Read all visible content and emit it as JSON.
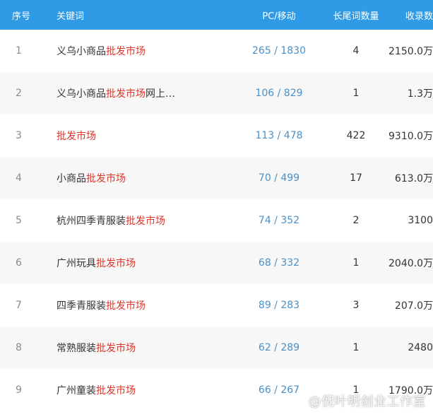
{
  "header": {
    "index": "序号",
    "keyword": "关键词",
    "pc_mobile": "PC/移动",
    "long_tail_count": "长尾词数量",
    "records": "收录数"
  },
  "rows": [
    {
      "index": "1",
      "kw_prefix": "义乌小商品",
      "kw_highlight": "批发市场",
      "kw_suffix": "",
      "pc_mobile": "265 / 1830",
      "long_tail": "4",
      "records": "2150.0万"
    },
    {
      "index": "2",
      "kw_prefix": "义乌小商品",
      "kw_highlight": "批发市场",
      "kw_suffix": "网上…",
      "pc_mobile": "106 / 829",
      "long_tail": "1",
      "records": "1.3万"
    },
    {
      "index": "3",
      "kw_prefix": "",
      "kw_highlight": "批发市场",
      "kw_suffix": "",
      "pc_mobile": "113 / 478",
      "long_tail": "422",
      "records": "9310.0万"
    },
    {
      "index": "4",
      "kw_prefix": "小商品",
      "kw_highlight": "批发市场",
      "kw_suffix": "",
      "pc_mobile": "70 / 499",
      "long_tail": "17",
      "records": "613.0万"
    },
    {
      "index": "5",
      "kw_prefix": "杭州四季青服装",
      "kw_highlight": "批发市场",
      "kw_suffix": "",
      "pc_mobile": "74 / 352",
      "long_tail": "2",
      "records": "3100"
    },
    {
      "index": "6",
      "kw_prefix": "广州玩具",
      "kw_highlight": "批发市场",
      "kw_suffix": "",
      "pc_mobile": "68 / 332",
      "long_tail": "1",
      "records": "2040.0万"
    },
    {
      "index": "7",
      "kw_prefix": "四季青服装",
      "kw_highlight": "批发市场",
      "kw_suffix": "",
      "pc_mobile": "89 / 283",
      "long_tail": "3",
      "records": "207.0万"
    },
    {
      "index": "8",
      "kw_prefix": "常熟服装",
      "kw_highlight": "批发市场",
      "kw_suffix": "",
      "pc_mobile": "62 / 289",
      "long_tail": "1",
      "records": "2480"
    },
    {
      "index": "9",
      "kw_prefix": "广州童装",
      "kw_highlight": "批发市场",
      "kw_suffix": "",
      "pc_mobile": "66 / 267",
      "long_tail": "1",
      "records": "1790.0万"
    }
  ],
  "watermark": "@倪叶明创业工作室",
  "colors": {
    "header_bg": "#2f9ae6",
    "highlight": "#d9372c",
    "pc_mobile": "#4a90c8",
    "alt_row_bg": "#f7f7f7"
  }
}
